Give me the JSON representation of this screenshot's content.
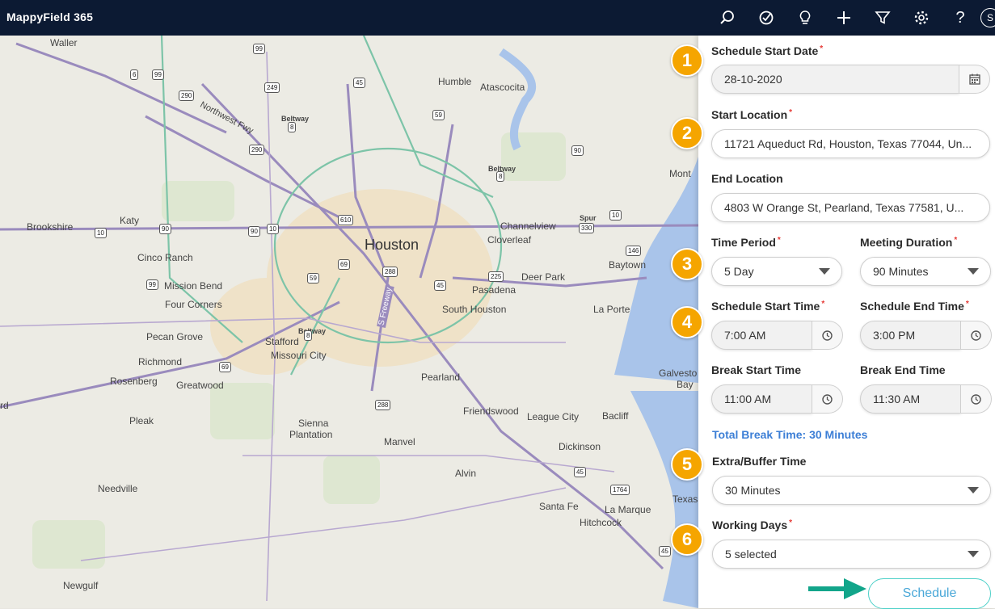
{
  "app": {
    "title": "MappyField 365",
    "avatar_initial": "S"
  },
  "toolbar": {
    "icons": [
      "search-icon",
      "check-circle-icon",
      "lightbulb-icon",
      "plus-icon",
      "filter-icon",
      "gear-icon",
      "help-icon"
    ],
    "help_label": "?"
  },
  "map": {
    "labels": {
      "waller": "Waller",
      "humble": "Humble",
      "atascocita": "Atascocita",
      "katy": "Katy",
      "brookshire": "Brookshire",
      "channelview": "Channelview",
      "cloverleaf": "Cloverleaf",
      "houston": "Houston",
      "cinco_ranch": "Cinco Ranch",
      "mission_bend": "Mission Bend",
      "four_corners": "Four Corners",
      "deer_park": "Deer Park",
      "pasadena": "Pasadena",
      "south_houston": "South Houston",
      "baytown": "Baytown",
      "la_porte": "La Porte",
      "pecan_grove": "Pecan Grove",
      "stafford": "Stafford",
      "missouri_city": "Missouri City",
      "richmond": "Richmond",
      "rosenberg": "Rosenberg",
      "greatwood": "Greatwood",
      "pearland": "Pearland",
      "friendswood": "Friendswood",
      "league_city": "League City",
      "bacliff": "Bacliff",
      "pleak": "Pleak",
      "sienna": "Sienna",
      "plantation": "Plantation",
      "manvel": "Manvel",
      "dickinson": "Dickinson",
      "alvin": "Alvin",
      "needville": "Needville",
      "santa_fe": "Santa Fe",
      "la_marque": "La Marque",
      "hitchcock": "Hitchcock",
      "newgulf": "Newgulf",
      "galveston": "Galvesto",
      "bay": "Bay",
      "texas": "Texas",
      "mont": "Mont",
      "rd": "rd",
      "northwest_fwy": "Northwest Fwy",
      "s_freeway": "S Freeway",
      "beltway": "Beltway",
      "spur": "Spur"
    },
    "shields": [
      "99",
      "6",
      "99",
      "249",
      "45",
      "59",
      "290",
      "8",
      "290",
      "90",
      "8",
      "10",
      "90",
      "90",
      "10",
      "610",
      "330",
      "10",
      "146",
      "69",
      "288",
      "225",
      "59",
      "99",
      "45",
      "8",
      "69",
      "288",
      "45",
      "1764",
      "45"
    ]
  },
  "form": {
    "start_date": {
      "label": "Schedule Start Date",
      "value": "28-10-2020"
    },
    "start_location": {
      "label": "Start Location",
      "value": "11721 Aqueduct Rd, Houston, Texas 77044, Un..."
    },
    "end_location": {
      "label": "End Location",
      "value": "4803 W Orange St, Pearland, Texas 77581, U..."
    },
    "time_period": {
      "label": "Time Period",
      "value": "5 Day"
    },
    "meeting_duration": {
      "label": "Meeting Duration",
      "value": "90 Minutes"
    },
    "start_time": {
      "label": "Schedule Start Time",
      "value": "7:00 AM"
    },
    "end_time": {
      "label": "Schedule End Time",
      "value": "3:00 PM"
    },
    "break_start": {
      "label": "Break Start Time",
      "value": "11:00 AM"
    },
    "break_end": {
      "label": "Break End Time",
      "value": "11:30 AM"
    },
    "total_break": "Total Break Time: 30 Minutes",
    "buffer": {
      "label": "Extra/Buffer Time",
      "value": "30 Minutes"
    },
    "working_days": {
      "label": "Working Days",
      "value": "5 selected"
    },
    "required_mark": "*",
    "schedule_button": "Schedule"
  },
  "badges": [
    "1",
    "2",
    "3",
    "4",
    "5",
    "6"
  ],
  "colors": {
    "topbar": "#0c1a33",
    "badge": "#f5a500",
    "link": "#3d7fd6",
    "arrow": "#12a58a",
    "button_border": "#4dd0c8"
  }
}
